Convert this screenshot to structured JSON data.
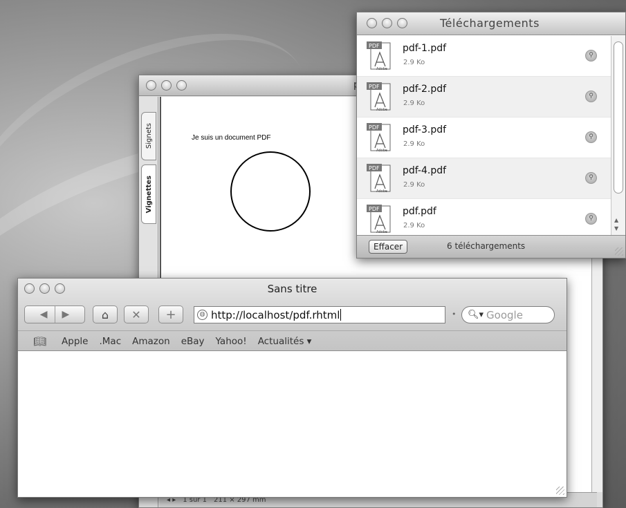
{
  "pdf_viewer": {
    "title_partial": "p",
    "drawer_tabs": [
      "Signets",
      "Vignettes"
    ],
    "document_text": "Je suis un document PDF",
    "status": {
      "page": "1 sur 1",
      "size": "211 × 297 mm"
    }
  },
  "downloads": {
    "title": "Téléchargements",
    "items": [
      {
        "name": "pdf-1.pdf",
        "size": "2.9 Ko"
      },
      {
        "name": "pdf-2.pdf",
        "size": "2.9 Ko"
      },
      {
        "name": "pdf-3.pdf",
        "size": "2.9 Ko"
      },
      {
        "name": "pdf-4.pdf",
        "size": "2.9 Ko"
      },
      {
        "name": "pdf.pdf",
        "size": "2.9 Ko"
      }
    ],
    "clear_label": "Effacer",
    "count_label": "6 téléchargements",
    "pdf_badge": "PDF",
    "adobe_label": "Adobe"
  },
  "safari": {
    "title": "Sans titre",
    "url": "http://localhost/pdf.rhtml",
    "search_placeholder": "Google",
    "bookmarks": [
      "Apple",
      ".Mac",
      "Amazon",
      "eBay",
      "Yahoo!",
      "Actualités ▾"
    ]
  }
}
